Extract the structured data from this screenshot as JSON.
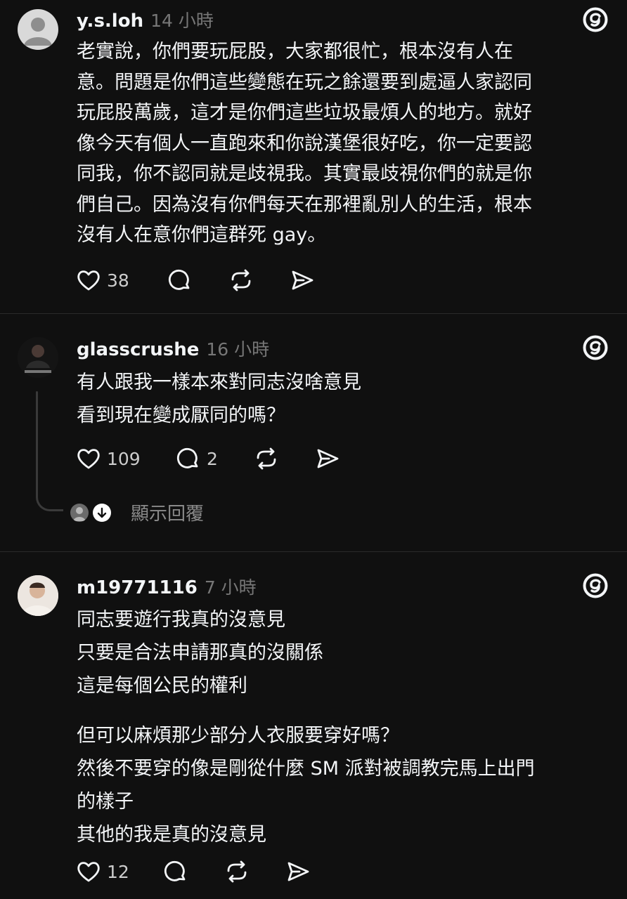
{
  "posts": [
    {
      "username": "y.s.loh",
      "time": "14 小時",
      "lines": [
        "老實說，你們要玩屁股，大家都很忙，根本沒有人在",
        "意。問題是你們這些變態在玩之餘還要到處逼人家認同",
        "玩屁股萬歲，這才是你們這些垃圾最煩人的地方。就好",
        "像今天有個人一直跑來和你說漢堡很好吃，你一定要認",
        "同我，你不認同就是歧視我。其實最歧視你們的就是你",
        "們自己。因為沒有你們每天在那裡亂別人的生活，根本",
        "沒有人在意你們這群死 gay。"
      ],
      "likes": "38",
      "comments": ""
    },
    {
      "username": "glasscrushe",
      "time": "16 小時",
      "lines": [
        "有人跟我一樣本來對同志沒啥意見",
        "看到現在變成厭同的嗎？"
      ],
      "likes": "109",
      "comments": "2",
      "show_replies": "顯示回覆"
    },
    {
      "username": "m19771116",
      "time": "7 小時",
      "lines": [
        "同志要遊行我真的沒意見",
        "只要是合法申請那真的沒關係",
        "這是每個公民的權利",
        "",
        "但可以麻煩那少部分人衣服要穿好嗎？",
        "然後不要穿的像是剛從什麼 SM 派對被調教完馬上出門",
        "的樣子",
        "其他的我是真的沒意見"
      ],
      "likes": "12",
      "comments": ""
    }
  ],
  "icons": {
    "like": "heart-icon",
    "comment": "comment-icon",
    "repost": "repost-icon",
    "share": "share-icon",
    "app": "threads-logo-icon"
  },
  "colors": {
    "background": "#101010",
    "text": "#f3f5f7",
    "muted": "#777777",
    "separator": "#2a2a2a"
  }
}
